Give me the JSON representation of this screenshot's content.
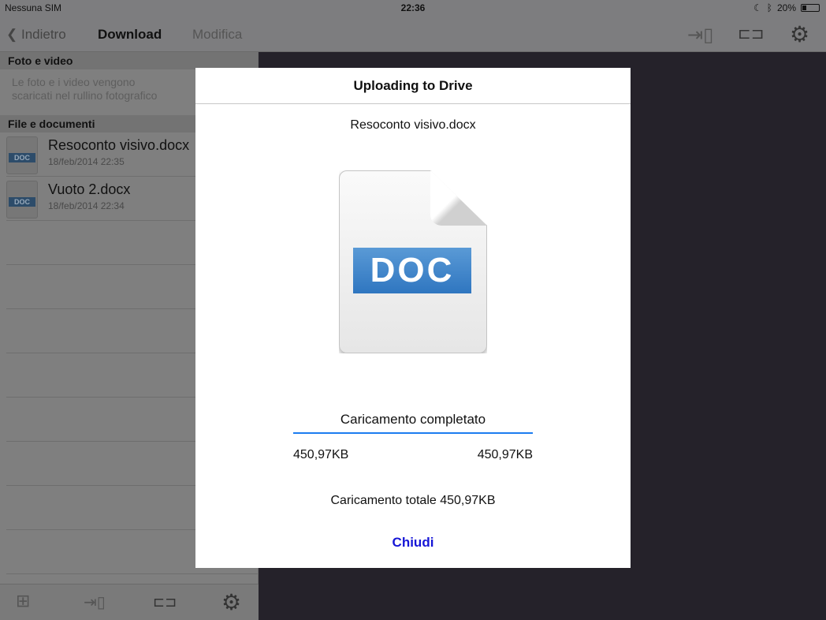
{
  "status": {
    "carrier": "Nessuna SIM",
    "time": "22:36",
    "battery": "20%"
  },
  "nav": {
    "back": "Indietro",
    "title": "Download",
    "edit": "Modifica"
  },
  "sections": {
    "photos": "Foto e video",
    "photos_info_1": "Le foto e i video vengono",
    "photos_info_2": "scaricati nel rullino fotografico",
    "files": "File e documenti"
  },
  "files": [
    {
      "name": "Resoconto visivo.docx",
      "date": "18/feb/2014 22:35",
      "badge": "DOC"
    },
    {
      "name": "Vuoto 2.docx",
      "date": "18/feb/2014 22:34",
      "badge": "DOC"
    }
  ],
  "modal": {
    "title": "Uploading to Drive",
    "filename": "Resoconto visivo.docx",
    "doc_label": "DOC",
    "status": "Caricamento completato",
    "progress": 1.0,
    "uploaded": "450,97KB",
    "size": "450,97KB",
    "total": "Caricamento totale 450,97KB",
    "close": "Chiudi",
    "accent": "#1c7cf0"
  }
}
